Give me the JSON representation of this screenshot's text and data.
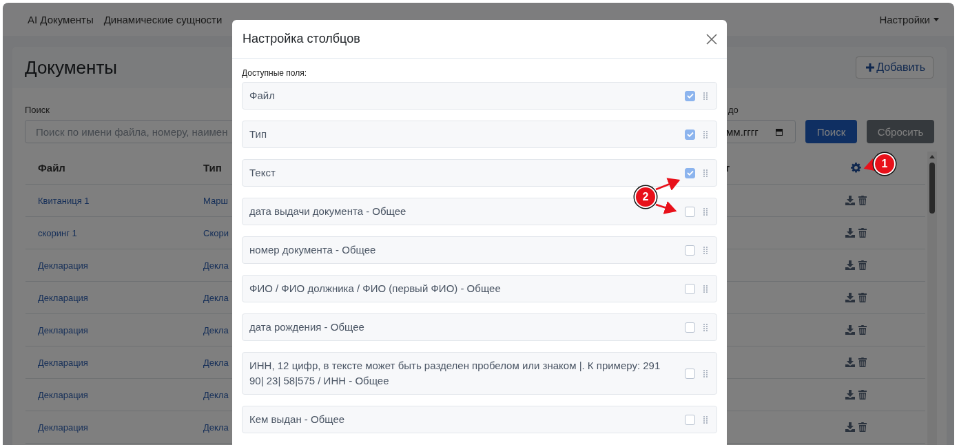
{
  "navbar": {
    "links": [
      {
        "label": "AI Документы"
      },
      {
        "label": "Динамические сущности"
      }
    ],
    "settings_menu": "Настройки"
  },
  "page": {
    "title": "Документы",
    "add_button": "Добавить"
  },
  "filters": {
    "search": {
      "label": "Поиск",
      "placeholder": "Поиск по имени файла, номеру, наимен"
    },
    "date_to": {
      "label": "до",
      "placeholder": "мм.гггг"
    },
    "search_button": "Поиск",
    "reset_button": "Сбросить"
  },
  "table": {
    "columns": [
      "Файл",
      "Тип",
      "т"
    ],
    "rows": [
      {
        "file": "Квитаниця 1",
        "type": "Марш"
      },
      {
        "file": "скоринг 1",
        "type": "Скори"
      },
      {
        "file": "Декларация",
        "type": "Декла"
      },
      {
        "file": "Декларация",
        "type": "Декла"
      },
      {
        "file": "Декларация",
        "type": "Декла"
      },
      {
        "file": "Декларация",
        "type": "Декла"
      },
      {
        "file": "Декларация",
        "type": "Декла"
      },
      {
        "file": "Декларация",
        "type": "Декла"
      }
    ]
  },
  "modal": {
    "title": "Настройка столбцов",
    "fields_label": "Доступные поля:",
    "fields": [
      {
        "label": "Файл",
        "checked": true
      },
      {
        "label": "Тип",
        "checked": true
      },
      {
        "label": "Текст",
        "checked": true
      },
      {
        "label": "дата выдачи документа - Общее",
        "checked": false
      },
      {
        "label": "номер документа - Общее",
        "checked": false
      },
      {
        "label": "ФИО / ФИО должника / ФИО (первый ФИО) - Общее",
        "checked": false
      },
      {
        "label": "дата рождения - Общее",
        "checked": false
      },
      {
        "label": "ИНН, 12 цифр, в тексте может быть разделен пробелом или знаком |. К примеру: 291 90| 23| 58|575 / ИНН - Общее",
        "checked": false
      },
      {
        "label": "Кем выдан - Общее",
        "checked": false
      }
    ]
  },
  "annotations": [
    {
      "label": "1"
    },
    {
      "label": "2"
    }
  ]
}
